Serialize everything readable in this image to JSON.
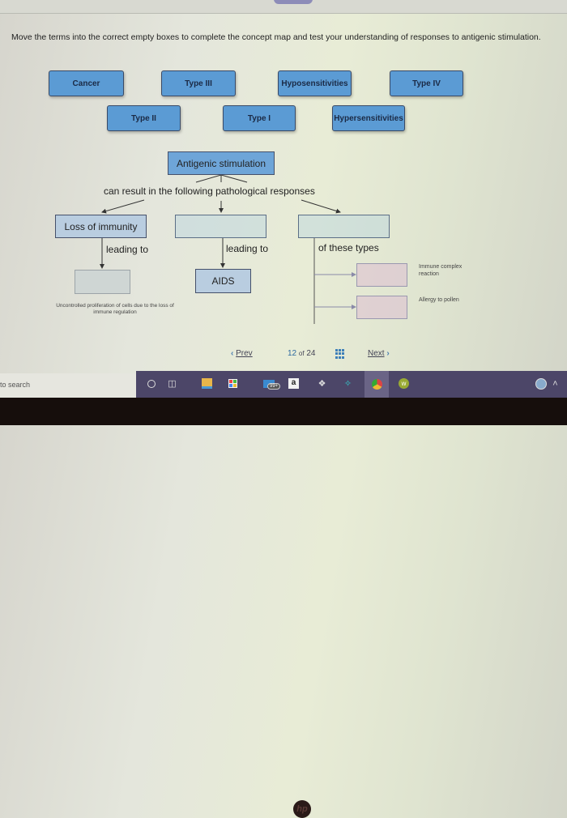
{
  "instructions": "Move the terms into the correct empty boxes to complete the concept map and test your understanding of responses to antigenic stimulation.",
  "term_bank": [
    "Cancer",
    "Type III",
    "Hyposensitivities",
    "Type IV",
    "Type II",
    "Type I",
    "Hypersensitivities"
  ],
  "concept_map": {
    "root": "Antigenic stimulation",
    "root_link": "can result in the following pathological responses",
    "branch1": {
      "node": "Loss of immunity",
      "link": "leading to",
      "hint": "Uncontrolled proliferation of cells due to the loss of immune regulation"
    },
    "branch2": {
      "node": "",
      "link": "leading to",
      "result": "AIDS"
    },
    "branch3": {
      "node": "",
      "link": "of these types",
      "hints": [
        "Immune complex reaction",
        "Allergy to pollen"
      ]
    }
  },
  "pagination": {
    "prev": "Prev",
    "current": "12",
    "of": "of",
    "total": "24",
    "next": "Next"
  },
  "taskbar": {
    "search_placeholder": "to search",
    "mail_badge": "99+",
    "icons": [
      "cortana-icon",
      "task-view-icon",
      "file-explorer-icon",
      "store-icon",
      "mail-icon",
      "amazon-icon",
      "dropbox-icon",
      "app-icon",
      "chrome-icon",
      "w-app-icon",
      "help-icon",
      "chevron-up-icon"
    ]
  },
  "colors": {
    "term_fill": "#5b9bd4",
    "root_fill": "#6ea5d8",
    "taskbar": "#4c4668",
    "nav_accent": "#3e7fb8"
  }
}
